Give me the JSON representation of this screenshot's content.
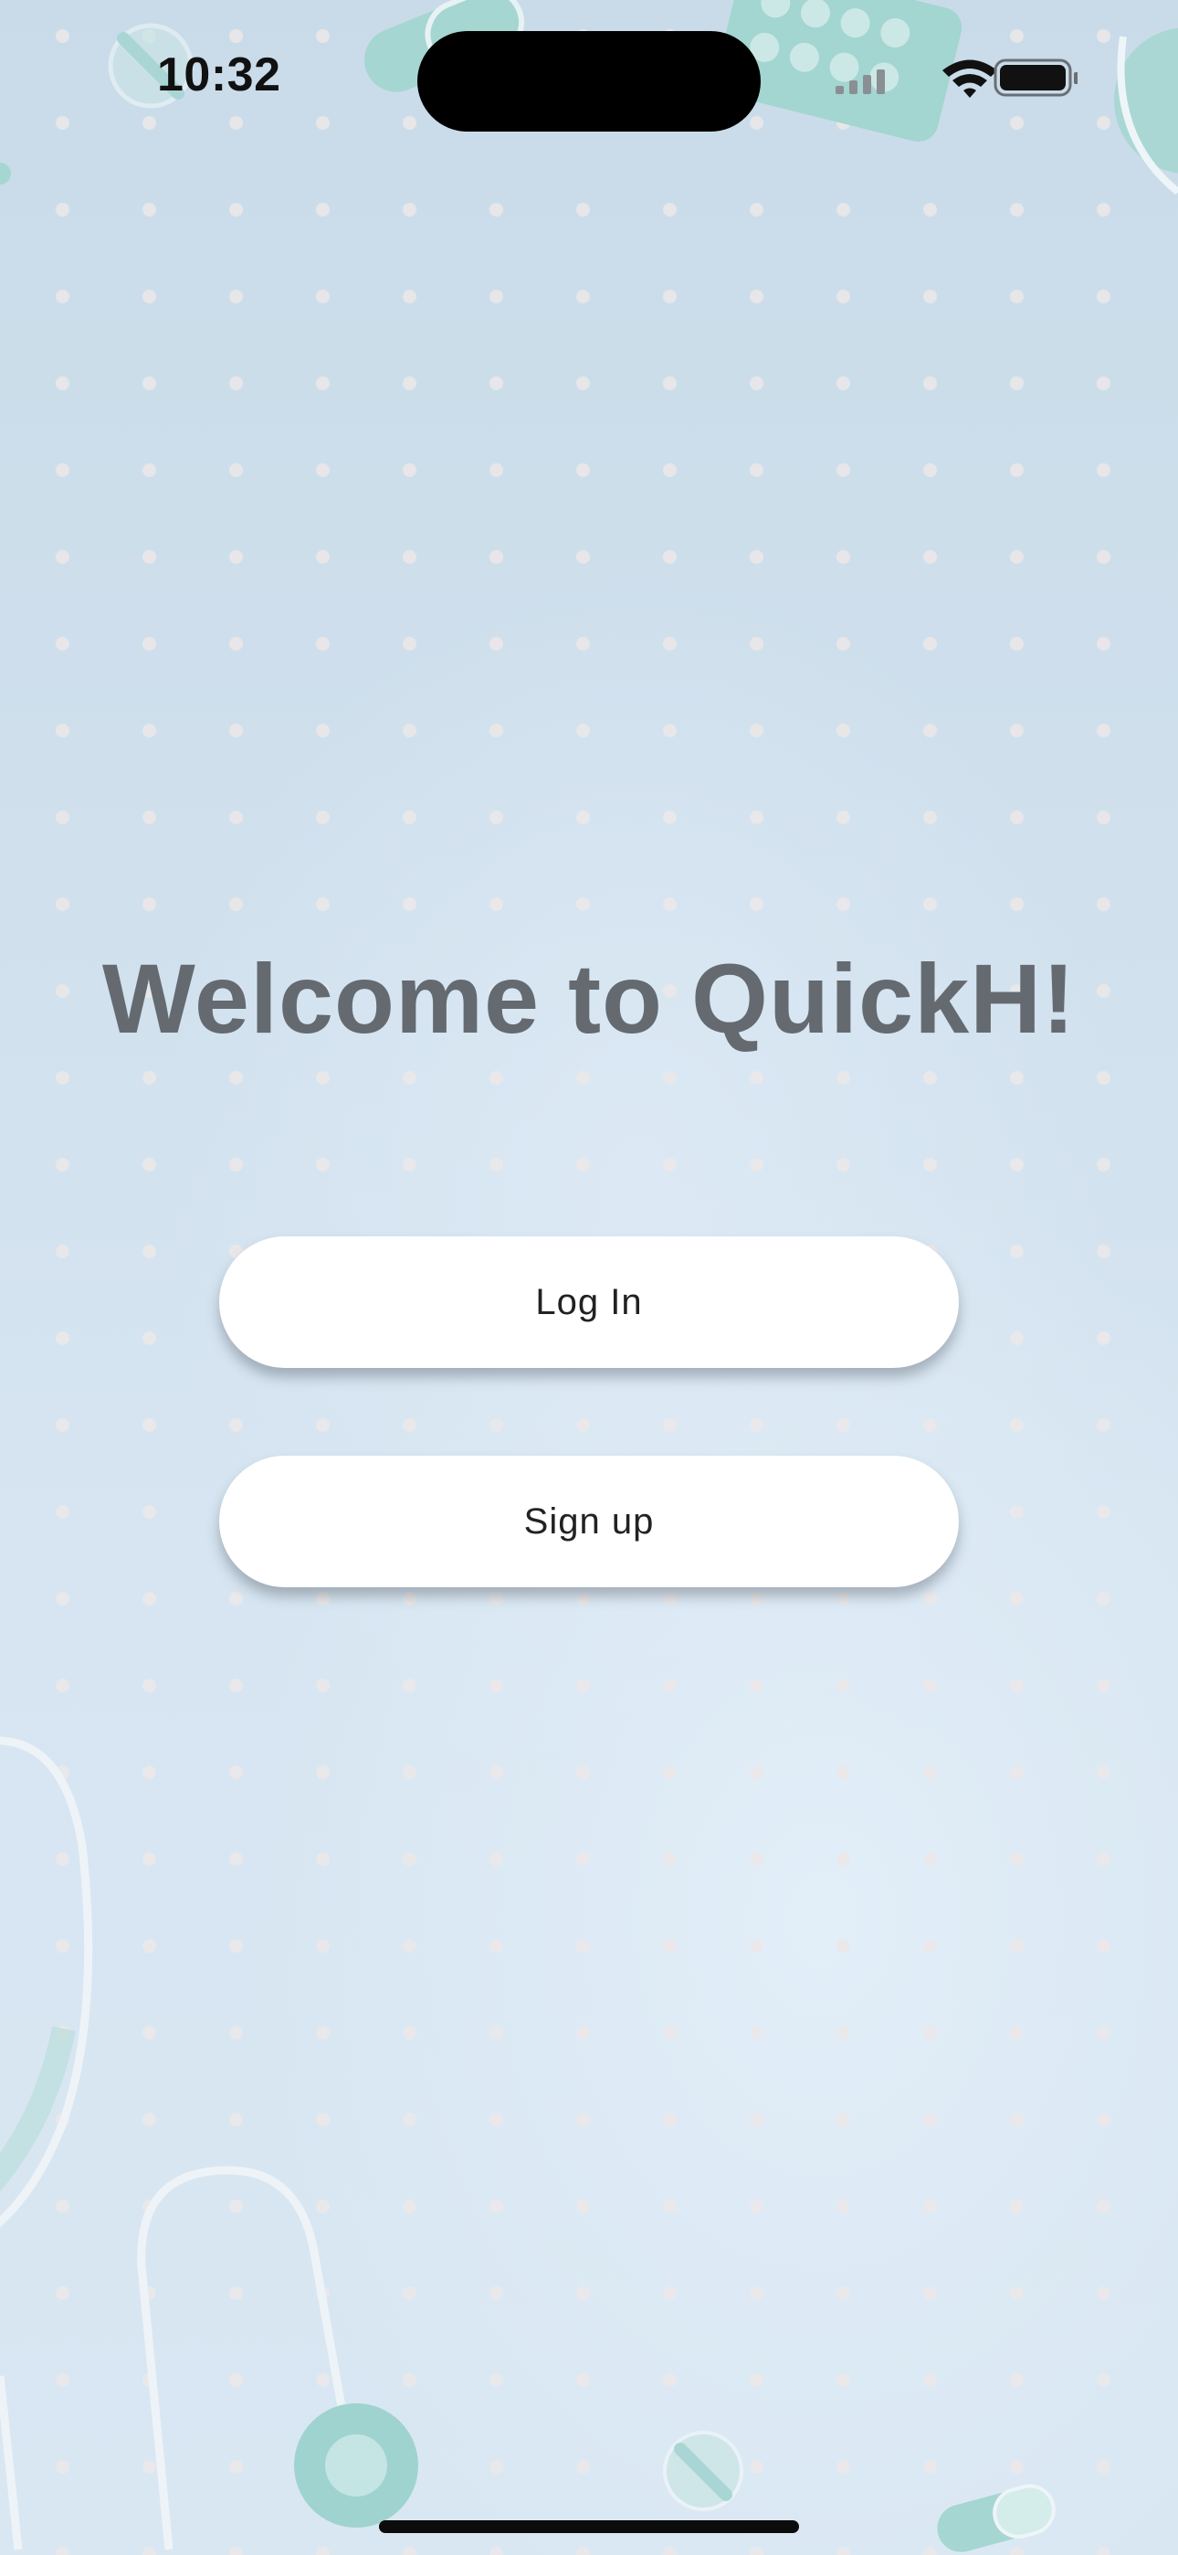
{
  "status_bar": {
    "time": "10:32"
  },
  "welcome": {
    "title": "Welcome to QuickH!"
  },
  "buttons": {
    "login_label": "Log In",
    "signup_label": "Sign up"
  },
  "colors": {
    "background": "#d3e3f0",
    "title_text": "#646a70",
    "button_bg": "#ffffff",
    "button_text": "#222222",
    "decor_teal": "#9fd3cf",
    "decor_outline": "#eef4f8"
  },
  "icons": {
    "cellular": "cellular-signal-icon",
    "wifi": "wifi-icon",
    "battery": "battery-icon"
  }
}
